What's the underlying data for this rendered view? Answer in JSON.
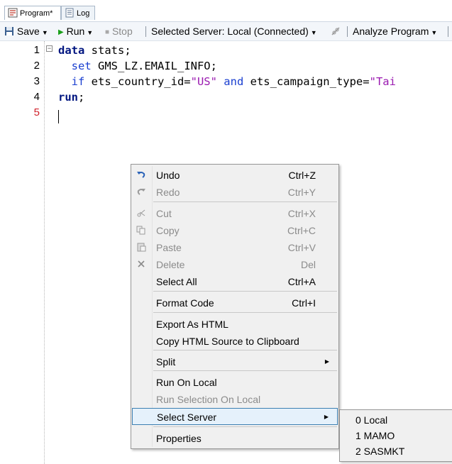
{
  "tabs": [
    {
      "label": "Program*",
      "icon": "program-icon",
      "active": true
    },
    {
      "label": "Log",
      "icon": "log-icon",
      "active": false
    }
  ],
  "toolbar": {
    "save_label": "Save",
    "run_label": "Run",
    "stop_label": "Stop",
    "server_label": "Selected Server: Local (Connected)",
    "analyze_label": "Analyze Program"
  },
  "editor": {
    "lines": [
      {
        "num": "1",
        "parts": [
          {
            "t": "data",
            "c": "kw"
          },
          {
            "t": " stats;",
            "c": ""
          }
        ]
      },
      {
        "num": "2",
        "parts": [
          {
            "t": "  set",
            "c": "kw2"
          },
          {
            "t": " GMS_LZ.EMAIL_INFO;",
            "c": ""
          }
        ]
      },
      {
        "num": "3",
        "parts": [
          {
            "t": "  if",
            "c": "kw2"
          },
          {
            "t": " ets_country_id=",
            "c": ""
          },
          {
            "t": "\"US\"",
            "c": "str"
          },
          {
            "t": " and",
            "c": "kw2"
          },
          {
            "t": " ets_campaign_type=",
            "c": ""
          },
          {
            "t": "\"Tai",
            "c": "str"
          }
        ]
      },
      {
        "num": "4",
        "parts": [
          {
            "t": "run",
            "c": "kw"
          },
          {
            "t": ";",
            "c": ""
          }
        ]
      },
      {
        "num": "5",
        "parts": []
      }
    ]
  },
  "context_menu": {
    "items": [
      {
        "label": "Undo",
        "shortcut": "Ctrl+Z",
        "icon": "undo-icon",
        "disabled": false
      },
      {
        "label": "Redo",
        "shortcut": "Ctrl+Y",
        "icon": "redo-icon",
        "disabled": true
      },
      {
        "label": "Cut",
        "shortcut": "Ctrl+X",
        "icon": "cut-icon",
        "disabled": true
      },
      {
        "label": "Copy",
        "shortcut": "Ctrl+C",
        "icon": "copy-icon",
        "disabled": true
      },
      {
        "label": "Paste",
        "shortcut": "Ctrl+V",
        "icon": "paste-icon",
        "disabled": true
      },
      {
        "label": "Delete",
        "shortcut": "Del",
        "icon": "delete-icon",
        "disabled": true
      },
      {
        "label": "Select All",
        "shortcut": "Ctrl+A",
        "disabled": false
      },
      {
        "label": "Format Code",
        "shortcut": "Ctrl+I",
        "disabled": false
      },
      {
        "label": "Export As HTML",
        "disabled": false
      },
      {
        "label": "Copy HTML Source to Clipboard",
        "disabled": false
      },
      {
        "label": "Split",
        "submenu": true,
        "disabled": false
      },
      {
        "label": "Run On Local",
        "disabled": false
      },
      {
        "label": "Run Selection On Local",
        "disabled": true
      },
      {
        "label": "Select Server",
        "submenu": true,
        "highlighted": true,
        "disabled": false
      },
      {
        "label": "Properties",
        "disabled": false
      }
    ]
  },
  "server_submenu": {
    "items": [
      "0 Local",
      "1 MAMO",
      "2 SASMKT"
    ]
  },
  "colors": {
    "keyword": "#001580",
    "string": "#9a1ab0",
    "highlight_border": "#3c7fb1"
  }
}
